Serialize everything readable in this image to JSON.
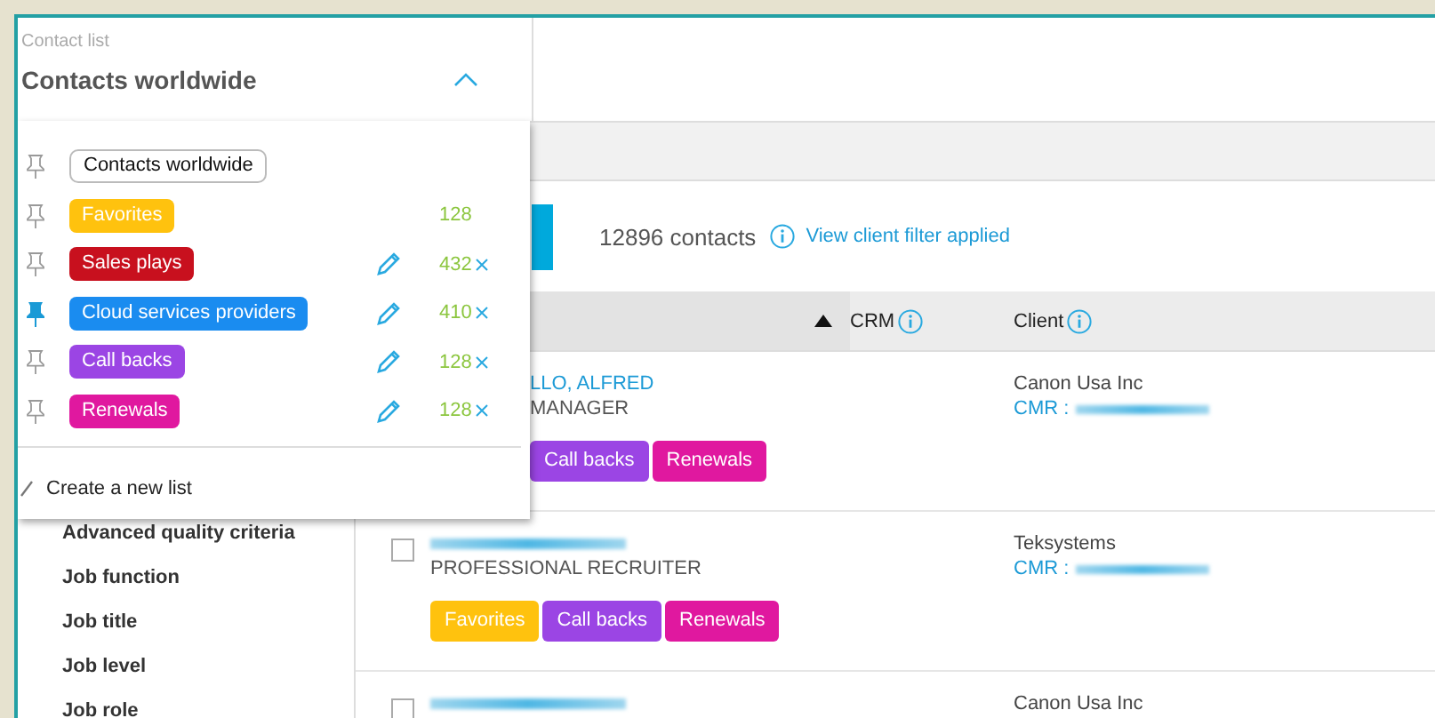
{
  "header": {
    "label": "Contact list",
    "title": "Contacts worldwide",
    "expanded": true
  },
  "dropdown": {
    "items": [
      {
        "kind": "plain",
        "label": "Contacts worldwide",
        "pinned": false
      },
      {
        "kind": "tag",
        "label": "Favorites",
        "color": "#ffc20e",
        "pinned": false,
        "count": "128",
        "editable": false,
        "removable": false
      },
      {
        "kind": "tag",
        "label": "Sales plays",
        "color": "#c8101e",
        "pinned": false,
        "count": "432",
        "editable": true,
        "removable": true
      },
      {
        "kind": "tag",
        "label": "Cloud services providers",
        "color": "#1a8cf0",
        "pinned": true,
        "count": "410",
        "editable": true,
        "removable": true
      },
      {
        "kind": "tag",
        "label": "Call backs",
        "color": "#9b45e4",
        "pinned": false,
        "count": "128",
        "editable": true,
        "removable": true
      },
      {
        "kind": "tag",
        "label": "Renewals",
        "color": "#e0189f",
        "pinned": false,
        "count": "128",
        "editable": true,
        "removable": true
      }
    ],
    "create": "Create a new list"
  },
  "sidebar": {
    "items": [
      "Advanced quality criteria",
      "Job function",
      "Job title",
      "Job level",
      "Job role"
    ]
  },
  "toolbar": {
    "count": "12896 contacts",
    "link": "View client filter applied"
  },
  "table": {
    "columns": [
      {
        "sorted": true
      },
      {
        "label": "CRM",
        "info": true
      },
      {
        "label": "Client",
        "info": true
      }
    ],
    "rows": [
      {
        "covered": true,
        "name": "LLO, ALFRED",
        "title": "MANAGER",
        "tags": [
          {
            "label": "Call backs",
            "color": "#9b45e4"
          },
          {
            "label": "Renewals",
            "color": "#e0189f"
          }
        ],
        "client": "Canon Usa Inc",
        "cmr": "CMR :"
      },
      {
        "covered": false,
        "name_redacted": true,
        "title": "PROFESSIONAL RECRUITER",
        "tags": [
          {
            "label": "Favorites",
            "color": "#ffc20e"
          },
          {
            "label": "Call backs",
            "color": "#9b45e4"
          },
          {
            "label": "Renewals",
            "color": "#e0189f"
          }
        ],
        "client": "Teksystems",
        "cmr": "CMR :"
      },
      {
        "covered": false,
        "name_redacted": true,
        "client": "Canon Usa Inc"
      }
    ]
  }
}
